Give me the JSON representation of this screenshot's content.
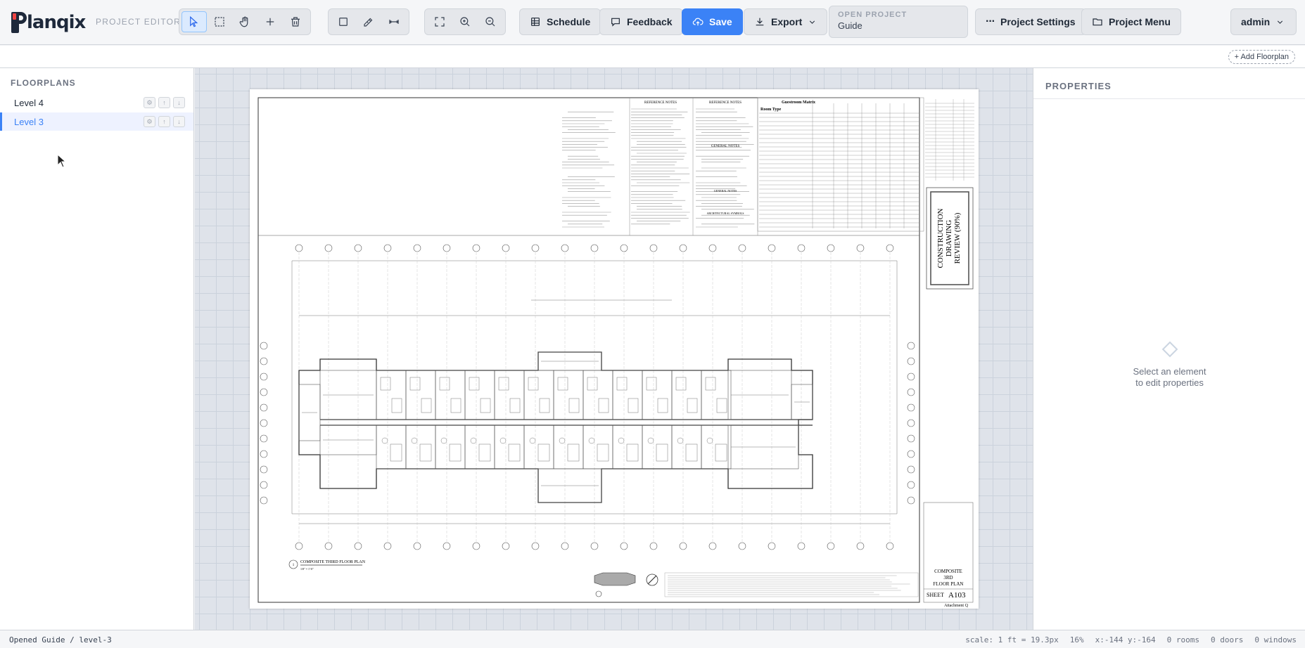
{
  "app": {
    "logo_text": "lanqix",
    "section": "PROJECT EDITOR"
  },
  "toolbar": {
    "tools": [
      {
        "name": "select-tool",
        "icon": "cursor-arrow-icon",
        "active": true
      },
      {
        "name": "marquee-tool",
        "icon": "dashed-square-icon"
      },
      {
        "name": "pan-tool",
        "icon": "hand-icon"
      },
      {
        "name": "add-tool",
        "icon": "plus-icon"
      },
      {
        "name": "delete-tool",
        "icon": "trash-icon"
      }
    ],
    "draw_tools": [
      "rectangle-icon",
      "pencil-ruler-icon",
      "dimension-icon"
    ],
    "view_tools": [
      "fit-screen-icon",
      "zoom-in-icon",
      "zoom-out-icon"
    ],
    "schedule_label": "Schedule",
    "feedback_label": "Feedback",
    "save_label": "Save",
    "export_label": "Export",
    "open_project_label": "OPEN PROJECT",
    "open_project_value": "Guide",
    "project_settings_label": "Project Settings",
    "project_menu_label": "Project Menu",
    "user_label": "admin"
  },
  "subbar": {
    "add_floorplan_label": "+ Add Floorplan"
  },
  "sidebar": {
    "title": "FLOORPLANS",
    "floors": [
      {
        "label": "Level 4",
        "selected": false
      },
      {
        "label": "Level 3",
        "selected": true
      }
    ]
  },
  "drawing": {
    "stamp_lines": [
      "CONSTRUCTION",
      "DRAWING",
      "REVIEW (90%)"
    ],
    "title_block_lines": [
      "COMPOSITE",
      "3RD",
      "FLOOR PLAN"
    ],
    "sheet_label": "SHEET",
    "sheet_number": "A103",
    "attachment": "Attachment Q",
    "plan_title": "COMPOSITE THIRD FLOOR PLAN",
    "plan_scale": "1/8\" = 1'-0\"",
    "plan_number": "1",
    "notes_headers": [
      "REFERENCE NOTES",
      "GENERAL NOTES",
      "GENERAL NOTES",
      "ARCHITECTURAL SYMBOLS"
    ],
    "matrix_title": "Guestroom Matrix",
    "matrix_header": "Room Type"
  },
  "properties": {
    "title": "PROPERTIES",
    "empty_line1": "Select an element",
    "empty_line2": "to edit properties"
  },
  "status": {
    "message": "Opened Guide / level-3",
    "scale": "scale: 1 ft = 19.3px",
    "zoom": "16%",
    "coords": "x:-144 y:-164",
    "rooms": "0 rooms",
    "doors": "0 doors",
    "windows": "0 windows"
  },
  "colors": {
    "accent": "#3b82f6",
    "canvas_bg": "#dfe3ea"
  }
}
